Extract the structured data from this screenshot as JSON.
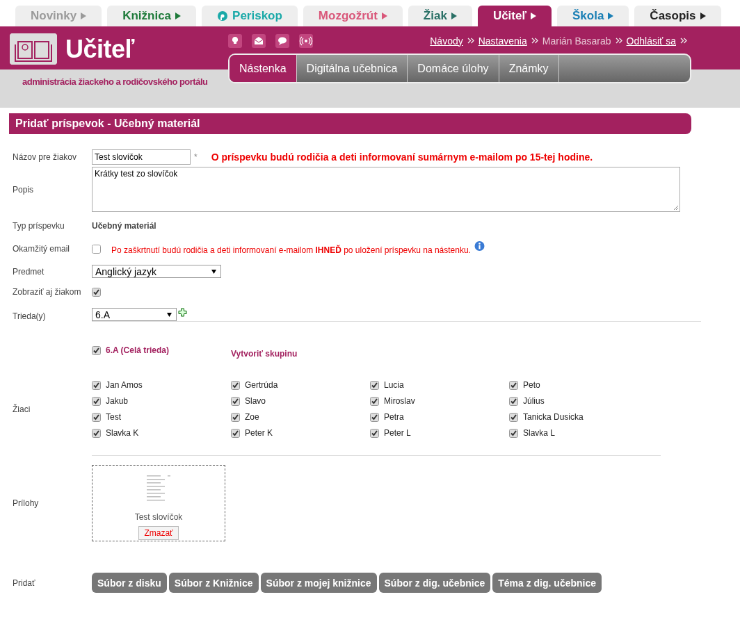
{
  "top_tabs": [
    {
      "label": "Novinky",
      "color": "#9a9a9a",
      "selected": false,
      "kind": "arrow"
    },
    {
      "label": "Knižnica",
      "color": "#1e7a3a",
      "selected": false,
      "kind": "arrow"
    },
    {
      "label": "Periskop",
      "color": "#1aa9a8",
      "selected": false,
      "kind": "logo"
    },
    {
      "label": "Mozgožrút",
      "color": "#d9577a",
      "selected": false,
      "kind": "arrow"
    },
    {
      "label": "Žiak",
      "color": "#2a7066",
      "selected": false,
      "kind": "arrow"
    },
    {
      "label": "Učiteľ",
      "color": "#a3215f",
      "selected": true,
      "kind": "arrow"
    },
    {
      "label": "Škola",
      "color": "#1a7fb5",
      "selected": false,
      "kind": "arrow"
    },
    {
      "label": "Časopis",
      "color": "#222222",
      "selected": false,
      "kind": "arrow"
    }
  ],
  "header": {
    "title": "Učiteľ",
    "subtitle": "administrácia žiackeho a rodičovského portálu",
    "links": [
      {
        "label": "Návody",
        "kind": "link"
      },
      {
        "label": "Nastavenia",
        "kind": "link"
      },
      {
        "label": "Marián Basarab",
        "kind": "text"
      },
      {
        "label": "Odhlásiť sa",
        "kind": "link"
      }
    ],
    "nav": [
      {
        "label": "Nástenka",
        "selected": true
      },
      {
        "label": "Digitálna učebnica",
        "selected": false
      },
      {
        "label": "Domáce úlohy",
        "selected": false
      },
      {
        "label": "Známky",
        "selected": false
      }
    ]
  },
  "form": {
    "title": "Pridať príspevok - Učebný materiál",
    "name": {
      "label": "Názov pre žiakov",
      "value": "Test slovíčok",
      "required_mark": "*",
      "notice": "O príspevku budú rodičia a deti informovaní sumárnym e-mailom po 15-tej hodine."
    },
    "description": {
      "label": "Popis",
      "value": "Krátky test zo slovíčok"
    },
    "type": {
      "label": "Typ príspevku",
      "value": "Učebný materiál"
    },
    "instant_email": {
      "label": "Okamžitý email",
      "checked": false,
      "note": "Po zaškrtnutí budú rodičia a deti informovaní e-mailom **IHNEĎ** po uložení príspevku na nástenku."
    },
    "subject": {
      "label": "Predmet",
      "value": "Anglický jazyk"
    },
    "show_students": {
      "label": "Zobraziť aj žiakom",
      "checked": true
    },
    "classes": {
      "label": "Trieda(y)",
      "value": "6.A"
    },
    "whole_class": {
      "label": "6.A (Celá trieda)",
      "checked": true
    },
    "create_group": "Vytvoriť skupinu",
    "students": {
      "label": "Žiaci",
      "items": [
        {
          "name": "Jan Amos",
          "checked": true
        },
        {
          "name": "Gertrúda",
          "checked": true
        },
        {
          "name": "Lucia",
          "checked": true
        },
        {
          "name": "Peto",
          "checked": true
        },
        {
          "name": "Jakub",
          "checked": true
        },
        {
          "name": "Slavo",
          "checked": true
        },
        {
          "name": "Miroslav",
          "checked": true
        },
        {
          "name": "Július",
          "checked": true
        },
        {
          "name": "Test",
          "checked": true
        },
        {
          "name": "Zoe",
          "checked": true
        },
        {
          "name": "Petra",
          "checked": true
        },
        {
          "name": "Tanicka Dusicka",
          "checked": true
        },
        {
          "name": "Slavka K",
          "checked": true
        },
        {
          "name": "Peter K",
          "checked": true
        },
        {
          "name": "Peter L",
          "checked": true
        },
        {
          "name": "Slavka L",
          "checked": true
        }
      ]
    },
    "attachments": {
      "label": "Prílohy",
      "items": [
        {
          "name": "Test slovíčok",
          "delete": "Zmazať"
        }
      ]
    },
    "add": {
      "label": "Pridať",
      "buttons": [
        "Súbor z disku",
        "Súbor z Knižnice",
        "Súbor z mojej knižnice",
        "Súbor z dig. učebnice",
        "Téma z dig. učebnice"
      ]
    }
  }
}
